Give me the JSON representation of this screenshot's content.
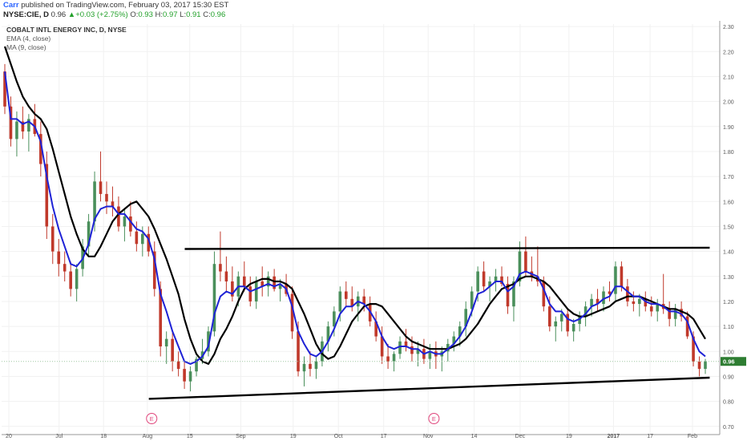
{
  "header": {
    "author": "Carr",
    "published": "published on TradingView.com, February 03, 2017 15:30 EST",
    "symbol": "NYSE:CIE, D",
    "last": "0.96",
    "change": "+0.03 (+2.75%)",
    "o_label": "O:",
    "o": "0.93",
    "h_label": "H:",
    "h": "0.97",
    "l_label": "L:",
    "l": "0.91",
    "c_label": "C:",
    "c": "0.96"
  },
  "legend": {
    "name": "COBALT INTL ENERGY INC, D, NYSE",
    "ema": "EMA (4, close)",
    "ma": "MA (9, close)"
  },
  "colors": {
    "up": "#4a8f5b",
    "down": "#c0392b",
    "ema": "#1e22d6",
    "ma": "#000000",
    "earnings": "#e0457b",
    "last_price_bg": "#2e7d32"
  },
  "chart_data": {
    "type": "candlestick",
    "ylim": [
      0.68,
      2.31
    ],
    "yticks": [
      "0.70",
      "0.80",
      "0.90",
      "1.00",
      "1.10",
      "1.20",
      "1.30",
      "1.40",
      "1.50",
      "1.60",
      "1.70",
      "1.80",
      "1.90",
      "2.00",
      "2.10",
      "2.20",
      "2.30"
    ],
    "xticks": [
      "20",
      "Jul",
      "18",
      "Aug",
      "15",
      "Sep",
      "19",
      "Oct",
      "17",
      "Nov",
      "14",
      "Dec",
      "19",
      "2017",
      "17",
      "Feb"
    ],
    "last_price_label": "0.96",
    "earnings_markers": [
      "E",
      "E"
    ],
    "candles_ohlc": [
      [
        2.12,
        2.15,
        1.95,
        1.98
      ],
      [
        1.98,
        2.02,
        1.82,
        1.85
      ],
      [
        1.85,
        1.96,
        1.78,
        1.92
      ],
      [
        1.92,
        1.98,
        1.85,
        1.88
      ],
      [
        1.88,
        1.95,
        1.8,
        1.93
      ],
      [
        1.93,
        1.99,
        1.86,
        1.87
      ],
      [
        1.87,
        1.92,
        1.7,
        1.75
      ],
      [
        1.75,
        1.8,
        1.45,
        1.5
      ],
      [
        1.5,
        1.55,
        1.35,
        1.4
      ],
      [
        1.4,
        1.45,
        1.3,
        1.35
      ],
      [
        1.35,
        1.4,
        1.28,
        1.32
      ],
      [
        1.32,
        1.36,
        1.22,
        1.25
      ],
      [
        1.25,
        1.35,
        1.2,
        1.33
      ],
      [
        1.33,
        1.45,
        1.3,
        1.42
      ],
      [
        1.42,
        1.55,
        1.38,
        1.52
      ],
      [
        1.52,
        1.72,
        1.48,
        1.68
      ],
      [
        1.68,
        1.8,
        1.6,
        1.63
      ],
      [
        1.63,
        1.68,
        1.55,
        1.6
      ],
      [
        1.6,
        1.66,
        1.54,
        1.58
      ],
      [
        1.58,
        1.62,
        1.48,
        1.5
      ],
      [
        1.5,
        1.57,
        1.44,
        1.54
      ],
      [
        1.54,
        1.6,
        1.46,
        1.48
      ],
      [
        1.48,
        1.52,
        1.4,
        1.43
      ],
      [
        1.43,
        1.5,
        1.38,
        1.47
      ],
      [
        1.47,
        1.5,
        1.38,
        1.4
      ],
      [
        1.4,
        1.44,
        1.22,
        1.25
      ],
      [
        1.25,
        1.28,
        0.98,
        1.02
      ],
      [
        1.02,
        1.08,
        0.95,
        1.05
      ],
      [
        1.05,
        1.08,
        0.92,
        0.96
      ],
      [
        0.96,
        1.0,
        0.9,
        0.93
      ],
      [
        0.93,
        0.96,
        0.85,
        0.88
      ],
      [
        0.88,
        0.94,
        0.84,
        0.92
      ],
      [
        0.92,
        0.98,
        0.9,
        0.97
      ],
      [
        0.97,
        1.05,
        0.95,
        1.0
      ],
      [
        1.0,
        1.1,
        0.98,
        1.08
      ],
      [
        1.08,
        1.4,
        1.06,
        1.35
      ],
      [
        1.35,
        1.48,
        1.28,
        1.32
      ],
      [
        1.32,
        1.38,
        1.24,
        1.28
      ],
      [
        1.28,
        1.34,
        1.2,
        1.22
      ],
      [
        1.22,
        1.32,
        1.18,
        1.3
      ],
      [
        1.3,
        1.36,
        1.24,
        1.26
      ],
      [
        1.26,
        1.3,
        1.18,
        1.2
      ],
      [
        1.2,
        1.3,
        1.17,
        1.28
      ],
      [
        1.28,
        1.34,
        1.22,
        1.26
      ],
      [
        1.26,
        1.32,
        1.22,
        1.3
      ],
      [
        1.3,
        1.33,
        1.24,
        1.25
      ],
      [
        1.25,
        1.29,
        1.2,
        1.27
      ],
      [
        1.27,
        1.31,
        1.22,
        1.23
      ],
      [
        1.23,
        1.26,
        1.05,
        1.08
      ],
      [
        1.08,
        1.12,
        0.9,
        0.92
      ],
      [
        0.92,
        0.98,
        0.86,
        0.95
      ],
      [
        0.95,
        1.0,
        0.9,
        0.93
      ],
      [
        0.93,
        0.98,
        0.89,
        0.96
      ],
      [
        0.96,
        1.06,
        0.94,
        1.04
      ],
      [
        1.04,
        1.12,
        1.0,
        1.1
      ],
      [
        1.1,
        1.18,
        1.06,
        1.16
      ],
      [
        1.16,
        1.26,
        1.12,
        1.24
      ],
      [
        1.24,
        1.28,
        1.18,
        1.21
      ],
      [
        1.21,
        1.26,
        1.16,
        1.18
      ],
      [
        1.18,
        1.24,
        1.12,
        1.22
      ],
      [
        1.22,
        1.25,
        1.16,
        1.19
      ],
      [
        1.19,
        1.22,
        1.1,
        1.12
      ],
      [
        1.12,
        1.16,
        1.04,
        1.06
      ],
      [
        1.06,
        1.1,
        0.95,
        0.98
      ],
      [
        0.98,
        1.03,
        0.93,
        0.96
      ],
      [
        0.96,
        1.0,
        0.92,
        0.99
      ],
      [
        0.99,
        1.06,
        0.97,
        1.04
      ],
      [
        1.04,
        1.09,
        1.0,
        1.02
      ],
      [
        1.02,
        1.06,
        0.96,
        0.99
      ],
      [
        0.99,
        1.04,
        0.94,
        1.01
      ],
      [
        1.01,
        1.05,
        0.95,
        0.97
      ],
      [
        0.97,
        1.03,
        0.93,
        1.0
      ],
      [
        1.0,
        1.04,
        0.93,
        0.98
      ],
      [
        0.98,
        1.02,
        0.92,
        1.0
      ],
      [
        1.0,
        1.05,
        0.96,
        1.03
      ],
      [
        1.03,
        1.08,
        1.0,
        1.06
      ],
      [
        1.06,
        1.12,
        1.02,
        1.1
      ],
      [
        1.1,
        1.2,
        1.06,
        1.17
      ],
      [
        1.17,
        1.26,
        1.14,
        1.24
      ],
      [
        1.24,
        1.34,
        1.2,
        1.32
      ],
      [
        1.32,
        1.36,
        1.24,
        1.26
      ],
      [
        1.26,
        1.3,
        1.2,
        1.28
      ],
      [
        1.28,
        1.33,
        1.24,
        1.3
      ],
      [
        1.3,
        1.34,
        1.26,
        1.27
      ],
      [
        1.27,
        1.3,
        1.15,
        1.18
      ],
      [
        1.18,
        1.3,
        1.12,
        1.28
      ],
      [
        1.28,
        1.44,
        1.26,
        1.4
      ],
      [
        1.4,
        1.46,
        1.3,
        1.32
      ],
      [
        1.32,
        1.38,
        1.28,
        1.3
      ],
      [
        1.3,
        1.42,
        1.26,
        1.28
      ],
      [
        1.28,
        1.3,
        1.16,
        1.18
      ],
      [
        1.18,
        1.22,
        1.08,
        1.1
      ],
      [
        1.1,
        1.14,
        1.04,
        1.12
      ],
      [
        1.12,
        1.17,
        1.08,
        1.15
      ],
      [
        1.15,
        1.17,
        1.06,
        1.08
      ],
      [
        1.08,
        1.13,
        1.04,
        1.11
      ],
      [
        1.11,
        1.16,
        1.08,
        1.14
      ],
      [
        1.14,
        1.2,
        1.1,
        1.18
      ],
      [
        1.18,
        1.23,
        1.14,
        1.21
      ],
      [
        1.21,
        1.25,
        1.16,
        1.19
      ],
      [
        1.19,
        1.26,
        1.16,
        1.24
      ],
      [
        1.24,
        1.28,
        1.2,
        1.23
      ],
      [
        1.23,
        1.36,
        1.2,
        1.34
      ],
      [
        1.34,
        1.36,
        1.24,
        1.26
      ],
      [
        1.26,
        1.29,
        1.18,
        1.2
      ],
      [
        1.2,
        1.24,
        1.16,
        1.19
      ],
      [
        1.19,
        1.23,
        1.14,
        1.21
      ],
      [
        1.21,
        1.24,
        1.16,
        1.18
      ],
      [
        1.18,
        1.22,
        1.14,
        1.16
      ],
      [
        1.16,
        1.21,
        1.12,
        1.19
      ],
      [
        1.19,
        1.31,
        1.15,
        1.17
      ],
      [
        1.17,
        1.2,
        1.1,
        1.13
      ],
      [
        1.13,
        1.19,
        1.1,
        1.17
      ],
      [
        1.17,
        1.2,
        1.12,
        1.14
      ],
      [
        1.14,
        1.16,
        1.05,
        1.06
      ],
      [
        1.06,
        1.08,
        0.94,
        0.96
      ],
      [
        0.96,
        0.98,
        0.9,
        0.93
      ],
      [
        0.93,
        0.97,
        0.91,
        0.96
      ]
    ],
    "ema_4": [
      2.12,
      1.93,
      1.93,
      1.91,
      1.92,
      1.9,
      1.84,
      1.7,
      1.58,
      1.49,
      1.42,
      1.35,
      1.34,
      1.37,
      1.43,
      1.53,
      1.57,
      1.58,
      1.58,
      1.55,
      1.55,
      1.52,
      1.49,
      1.48,
      1.45,
      1.37,
      1.23,
      1.16,
      1.08,
      1.02,
      0.96,
      0.95,
      0.96,
      0.98,
      1.02,
      1.15,
      1.22,
      1.24,
      1.23,
      1.26,
      1.26,
      1.24,
      1.25,
      1.26,
      1.27,
      1.26,
      1.27,
      1.25,
      1.18,
      1.08,
      1.03,
      0.99,
      0.98,
      1.0,
      1.04,
      1.09,
      1.15,
      1.18,
      1.18,
      1.2,
      1.19,
      1.16,
      1.12,
      1.06,
      1.02,
      1.01,
      1.02,
      1.02,
      1.01,
      1.01,
      0.99,
      1.0,
      0.99,
      0.99,
      1.01,
      1.03,
      1.06,
      1.1,
      1.16,
      1.23,
      1.24,
      1.26,
      1.28,
      1.28,
      1.24,
      1.26,
      1.31,
      1.32,
      1.31,
      1.3,
      1.25,
      1.19,
      1.16,
      1.16,
      1.13,
      1.12,
      1.13,
      1.15,
      1.18,
      1.19,
      1.21,
      1.22,
      1.26,
      1.26,
      1.24,
      1.22,
      1.22,
      1.2,
      1.19,
      1.19,
      1.18,
      1.16,
      1.16,
      1.15,
      1.12,
      1.05,
      1.0,
      0.98
    ],
    "ma_9": [
      2.22,
      2.15,
      2.08,
      2.02,
      1.98,
      1.95,
      1.93,
      1.89,
      1.81,
      1.72,
      1.63,
      1.54,
      1.47,
      1.41,
      1.38,
      1.38,
      1.42,
      1.47,
      1.52,
      1.55,
      1.57,
      1.59,
      1.6,
      1.57,
      1.54,
      1.49,
      1.43,
      1.37,
      1.3,
      1.23,
      1.13,
      1.05,
      0.99,
      0.96,
      0.95,
      0.99,
      1.05,
      1.09,
      1.14,
      1.2,
      1.25,
      1.27,
      1.28,
      1.29,
      1.29,
      1.28,
      1.28,
      1.27,
      1.25,
      1.2,
      1.15,
      1.09,
      1.03,
      0.99,
      0.97,
      0.98,
      1.02,
      1.07,
      1.12,
      1.15,
      1.18,
      1.19,
      1.19,
      1.18,
      1.15,
      1.12,
      1.09,
      1.06,
      1.04,
      1.03,
      1.02,
      1.01,
      1.01,
      1.01,
      1.01,
      1.02,
      1.03,
      1.05,
      1.08,
      1.11,
      1.15,
      1.19,
      1.22,
      1.25,
      1.26,
      1.27,
      1.29,
      1.3,
      1.3,
      1.29,
      1.28,
      1.26,
      1.23,
      1.2,
      1.17,
      1.15,
      1.14,
      1.14,
      1.15,
      1.16,
      1.17,
      1.18,
      1.2,
      1.21,
      1.22,
      1.22,
      1.22,
      1.21,
      1.2,
      1.19,
      1.18,
      1.17,
      1.17,
      1.16,
      1.15,
      1.13,
      1.09,
      1.05
    ]
  },
  "trendlines": [
    {
      "name": "resistance",
      "from": [
        0.255,
        1.41
      ],
      "to": [
        0.986,
        1.415
      ]
    },
    {
      "name": "support",
      "from": [
        0.205,
        0.81
      ],
      "to": [
        0.986,
        0.895
      ]
    }
  ]
}
